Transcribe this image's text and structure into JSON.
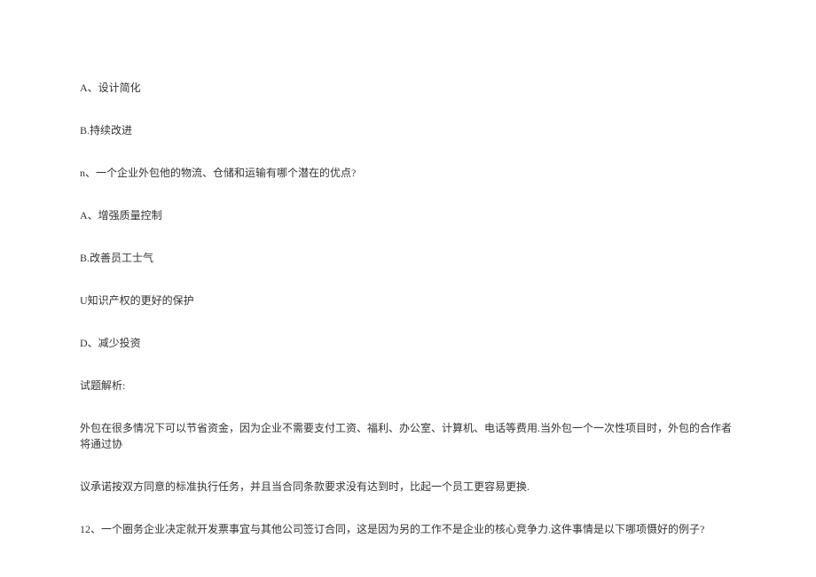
{
  "lines": [
    "A、设计简化",
    "B.持续改进",
    "n、一个企业外包他的物流、仓储和运输有哪个潜在的优点?",
    "A、增强质量控制",
    "B.改善员工士气",
    "U知识产权的更好的保护",
    "D、减少投资",
    "试题解析:",
    "外包在很多情况下可以节省资金，因为企业不需要支付工资、福利、办公室、计算机、电话等费用.当外包一个一次性项目时，外包的合作者将通过协",
    "议承诺按双方同意的标准执行任务，并且当合同条款要求没有达到时，比起一个员工更容易更换.",
    "12、一个圈务企业决定就开发票事宜与其他公司签订合同，这是因为另的工作不是企业的核心竞争力.这件事情是以下哪项慑好的例子?"
  ]
}
